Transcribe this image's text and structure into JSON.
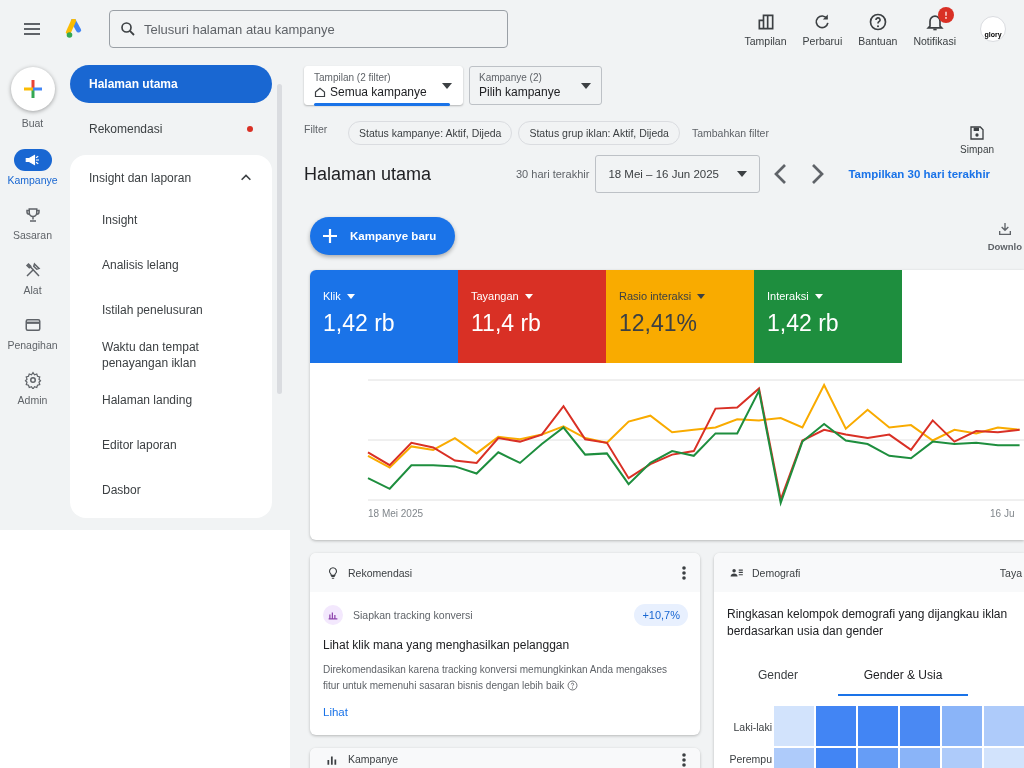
{
  "top_bar": {
    "search": {
      "placeholder": "Telusuri halaman atau kampanye"
    },
    "actions": [
      {
        "kind": "view",
        "label": "Tampilan"
      },
      {
        "kind": "refresh",
        "label": "Perbarui"
      },
      {
        "kind": "help",
        "label": "Bantuan"
      },
      {
        "kind": "notifications",
        "label": "Notifikasi",
        "alert": true
      }
    ],
    "account": {
      "label": "glory"
    }
  },
  "rail": {
    "create": {
      "label": "Buat"
    },
    "items": [
      {
        "kind": "campaign",
        "label": "Kampanye",
        "selected": true
      },
      {
        "kind": "goals",
        "label": "Sasaran",
        "selected": false
      },
      {
        "kind": "tools",
        "label": "Alat",
        "selected": false
      },
      {
        "kind": "billing",
        "label": "Penagihan",
        "selected": false
      },
      {
        "kind": "admin",
        "label": "Admin",
        "selected": false
      }
    ]
  },
  "nav": {
    "items": [
      {
        "label": "Halaman utama",
        "selected": true,
        "dot": false
      },
      {
        "label": "Rekomendasi",
        "selected": false,
        "dot": true
      }
    ],
    "group": {
      "label": "Insight dan laporan",
      "expanded": true,
      "children": [
        {
          "label": "Insight"
        },
        {
          "label": "Analisis lelang"
        },
        {
          "label": "Istilah penelusuran"
        },
        {
          "label": "Waktu dan tempat penayangan iklan"
        },
        {
          "label": "Halaman landing"
        },
        {
          "label": "Editor laporan"
        },
        {
          "label": "Dasbor"
        }
      ]
    }
  },
  "filters": {
    "view": {
      "caption": "Tampilan (2 filter)",
      "value": "Semua kampanye"
    },
    "campaign": {
      "caption": "Kampanye (2)",
      "value": "Pilih kampanye"
    },
    "label": "Filter",
    "chips": [
      "Status kampanye: Aktif, Dijeda",
      "Status grup iklan: Aktif, Dijeda"
    ],
    "add": "Tambahkan filter",
    "save": "Simpan"
  },
  "page": {
    "title": "Halaman utama",
    "range_label": "30 hari terakhir",
    "date_range": "18 Mei – 16 Jun 2025",
    "link": "Tampilkan 30 hari terakhir",
    "new_campaign": "Kampanye baru",
    "download": "Downlo"
  },
  "metrics": [
    {
      "label": "Klik",
      "value": "1,42 rb",
      "color": "#1a73e8"
    },
    {
      "label": "Tayangan",
      "value": "11,4 rb",
      "color": "#d93025"
    },
    {
      "label": "Rasio interaksi",
      "value": "12,41%",
      "color": "#f9ab00"
    },
    {
      "label": "Interaksi",
      "value": "1,42 rb",
      "color": "#1e8e3e"
    }
  ],
  "chart": {
    "x_start": "18 Mei 2025",
    "x_end": "16 Ju"
  },
  "recommendation_card": {
    "title": "Rekomendasi",
    "item": "Siapkan tracking konversi",
    "badge": "+10,7%",
    "headline": "Lihat klik mana yang menghasilkan pelanggan",
    "body": "Direkomendasikan karena tracking konversi memungkinkan Anda mengakses fitur untuk memenuhi sasaran bisnis dengan lebih baik",
    "link": "Lihat"
  },
  "demographics_card": {
    "title": "Demografi",
    "action": "Taya",
    "summary": "Ringkasan kelompok demografi yang dijangkau iklan berdasarkan usia dan gender",
    "tabs": [
      {
        "label": "Gender",
        "selected": false
      },
      {
        "label": "Gender & Usia",
        "selected": true
      }
    ],
    "rows": [
      "Laki-laki",
      "Perempu"
    ]
  },
  "campaign_card": {
    "title": "Kampanye"
  }
}
